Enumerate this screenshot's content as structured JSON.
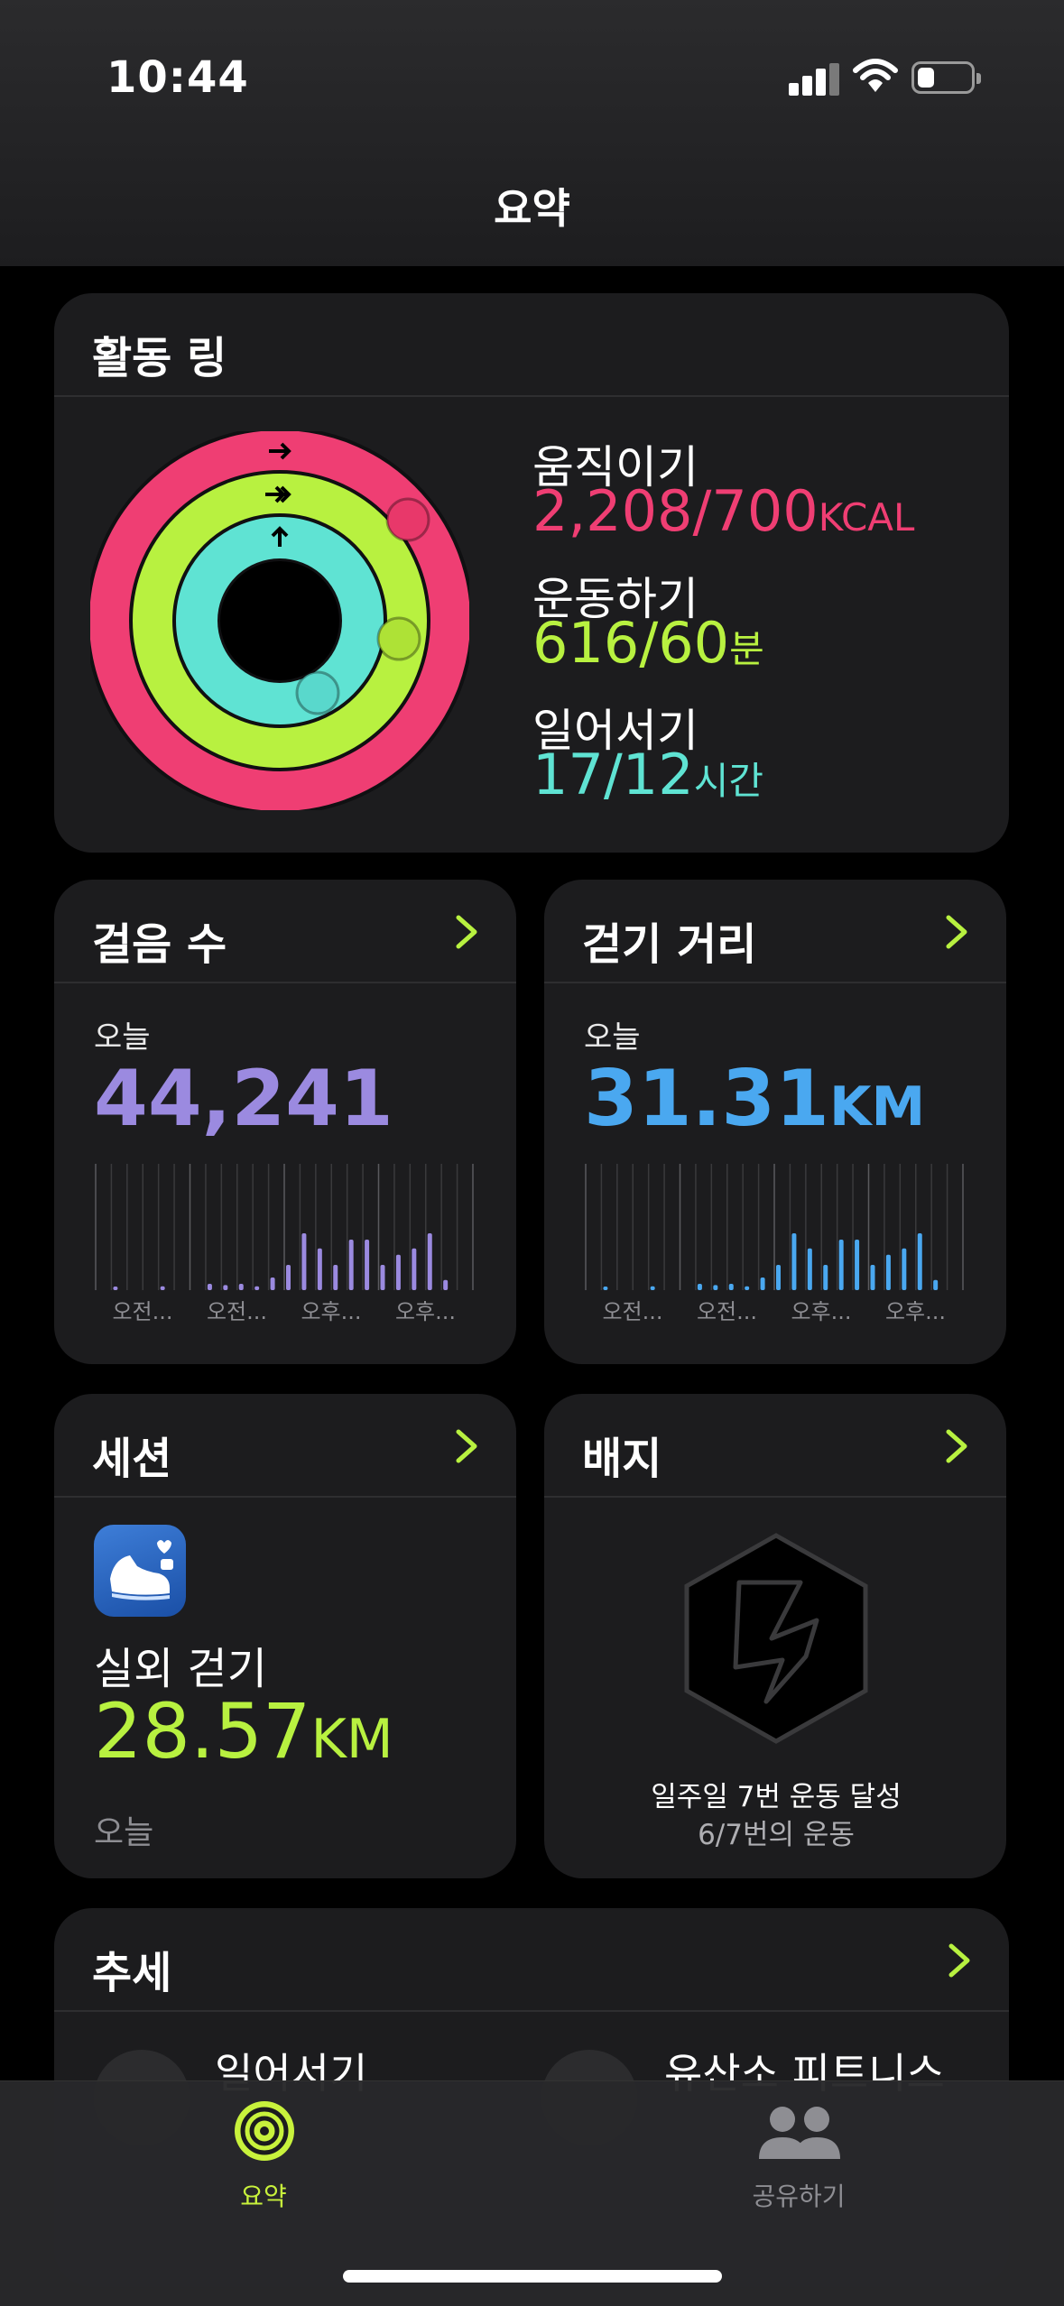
{
  "status_bar": {
    "time": "10:44"
  },
  "header": {
    "title": "요약"
  },
  "activity": {
    "title": "활동 링",
    "move": {
      "label": "움직이기",
      "value": "2,208/700",
      "unit": "KCAL"
    },
    "exercise": {
      "label": "운동하기",
      "value": "616/60",
      "unit": "분"
    },
    "stand": {
      "label": "일어서기",
      "value": "17/12",
      "unit": "시간"
    },
    "colors": {
      "move": "#ef3e73",
      "exercise": "#b8f140",
      "stand": "#5fe3d3"
    }
  },
  "steps": {
    "title": "걸음 수",
    "today_label": "오늘",
    "value": "44,241",
    "color": "#9b8ae0",
    "axis_labels": [
      "오전...",
      "오전...",
      "오후...",
      "오후..."
    ],
    "hourly": [
      0.02,
      0,
      0,
      0.03,
      0,
      0,
      0.05,
      0.04,
      0.05,
      0.03,
      0.1,
      0.2,
      0.45,
      0.33,
      0.2,
      0.4,
      0.4,
      0.2,
      0.28,
      0.33,
      0.45,
      0.08
    ]
  },
  "distance": {
    "title": "걷기 거리",
    "today_label": "오늘",
    "value": "31.31",
    "unit": "KM",
    "color": "#4aa8f0",
    "axis_labels": [
      "오전...",
      "오전...",
      "오후...",
      "오후..."
    ],
    "hourly": [
      0.02,
      0,
      0,
      0.03,
      0,
      0,
      0.05,
      0.04,
      0.05,
      0.03,
      0.1,
      0.2,
      0.45,
      0.33,
      0.2,
      0.4,
      0.4,
      0.2,
      0.28,
      0.33,
      0.45,
      0.08
    ]
  },
  "sessions": {
    "title": "세션",
    "workout_name": "실외 걷기",
    "value": "28.57",
    "unit": "KM",
    "date": "오늘",
    "icon": "walking-shoe-icon"
  },
  "badges": {
    "title": "배지",
    "name": "일주일 7번 운동 달성",
    "progress": "6/7번의 운동",
    "icon": "hexagon-badge-icon"
  },
  "trends": {
    "title": "추세",
    "items": [
      "일어서기",
      "유산소 피트니스"
    ]
  },
  "tabbar": {
    "tabs": [
      {
        "label": "요약",
        "icon": "activity-rings-icon",
        "active": true
      },
      {
        "label": "공유하기",
        "icon": "people-icon",
        "active": false
      }
    ],
    "active_color": "#c8f23c",
    "inactive_color": "#8e8e93"
  }
}
